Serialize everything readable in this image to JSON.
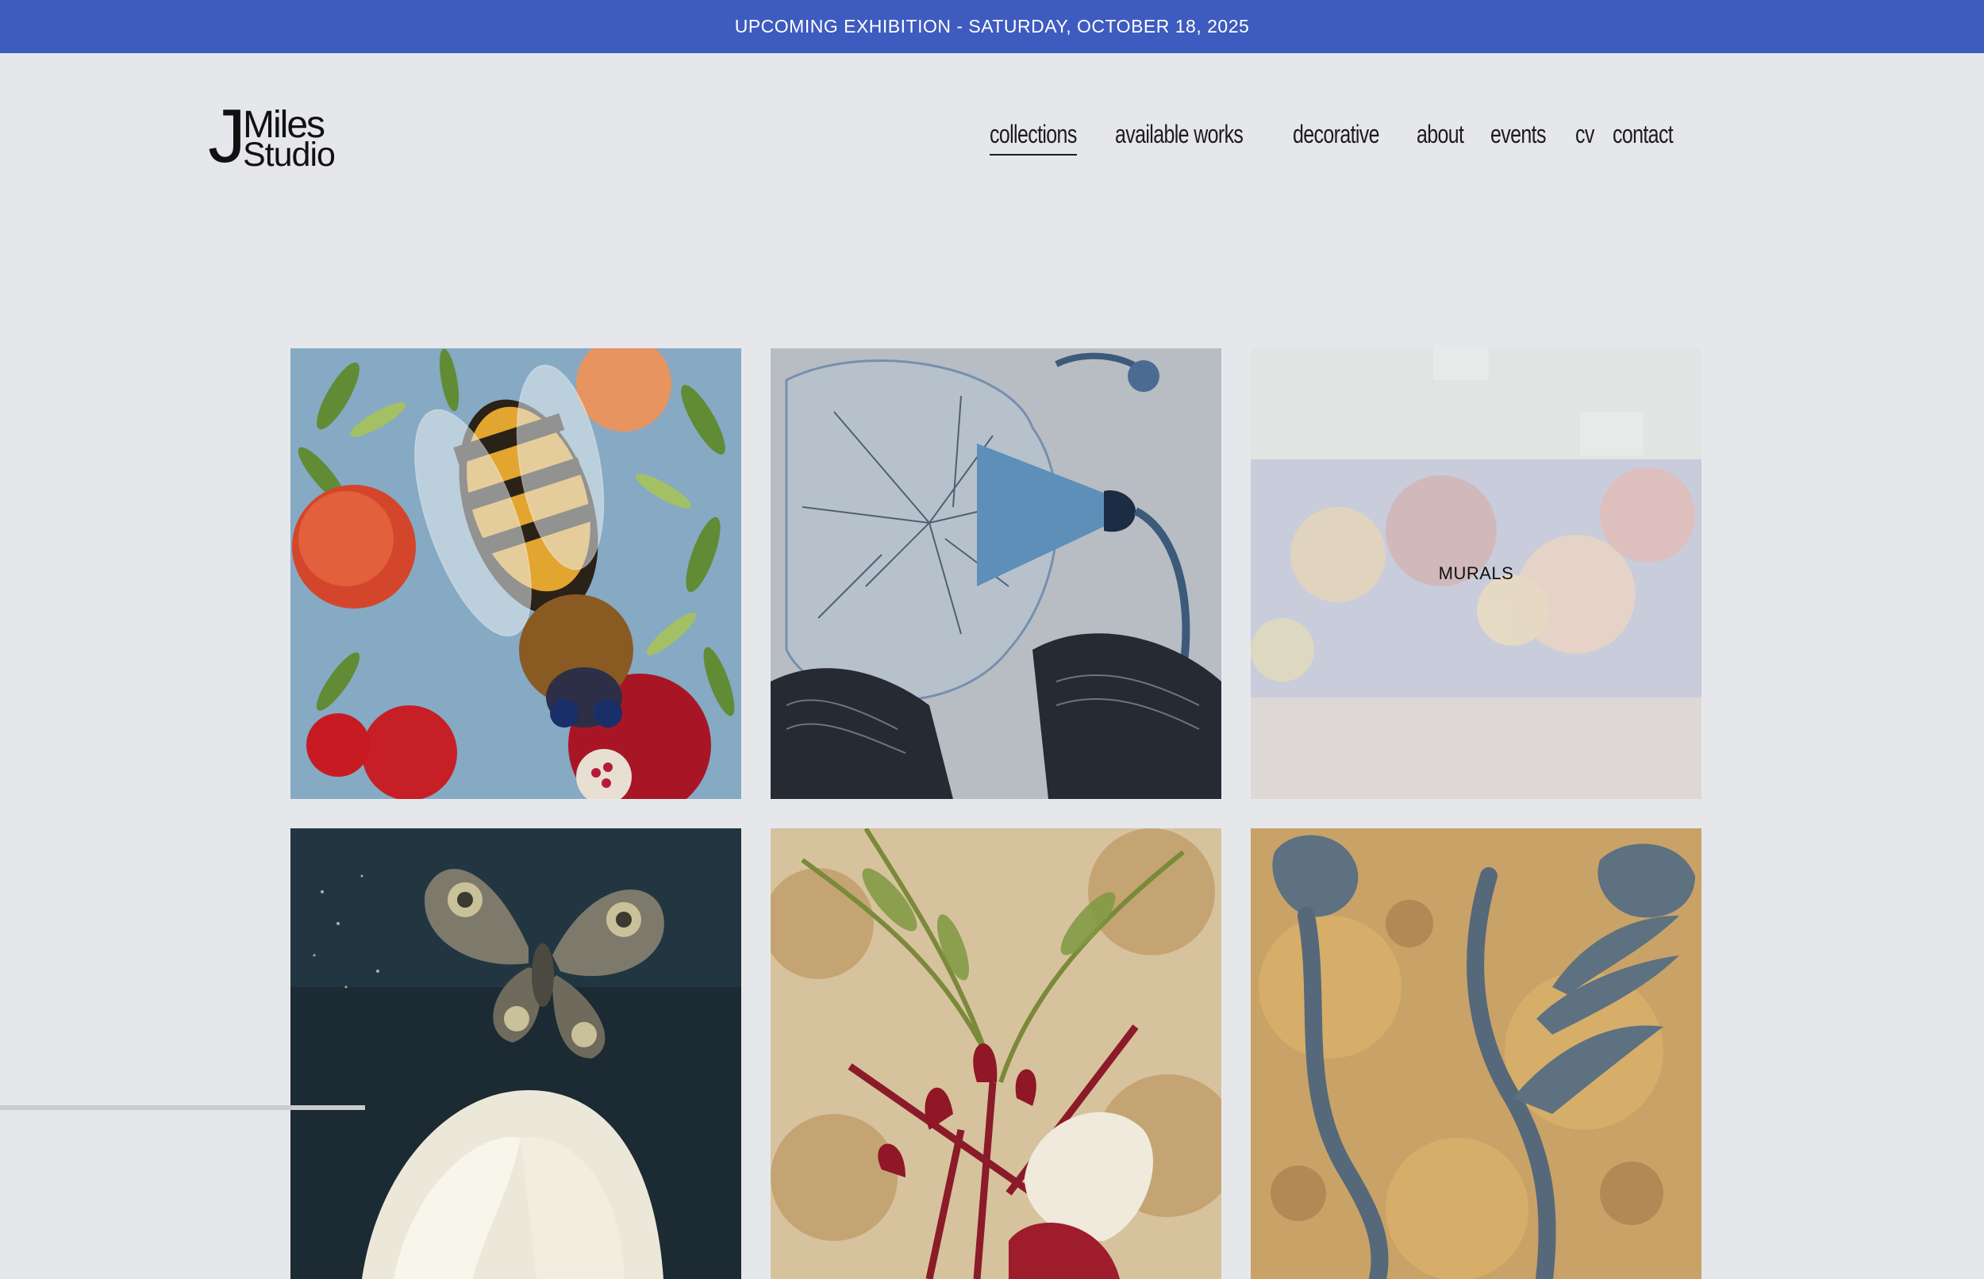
{
  "announcement": {
    "text": "UPCOMING EXHIBITION - SATURDAY, OCTOBER 18, 2025",
    "background": "#3e5bbf"
  },
  "logo": {
    "letter": "J",
    "line1": "Miles",
    "line2": "Studio"
  },
  "nav": {
    "items": [
      {
        "label": "collections",
        "active": true
      },
      {
        "label": "available works",
        "active": false
      },
      {
        "label": "decorative",
        "active": false
      },
      {
        "label": "about",
        "active": false
      },
      {
        "label": "events",
        "active": false
      },
      {
        "label": "cv",
        "active": false
      },
      {
        "label": "contact",
        "active": false
      }
    ]
  },
  "gallery": {
    "tiles": [
      {
        "name": "bee-pomegranate-painting",
        "overlay": ""
      },
      {
        "name": "blue-flower-silver-painting",
        "overlay": ""
      },
      {
        "name": "murals-tile",
        "overlay": "MURALS"
      },
      {
        "name": "moth-white-flower-painting",
        "overlay": ""
      },
      {
        "name": "red-botanical-gold-painting",
        "overlay": ""
      },
      {
        "name": "blue-artichoke-gold-painting",
        "overlay": ""
      }
    ]
  }
}
